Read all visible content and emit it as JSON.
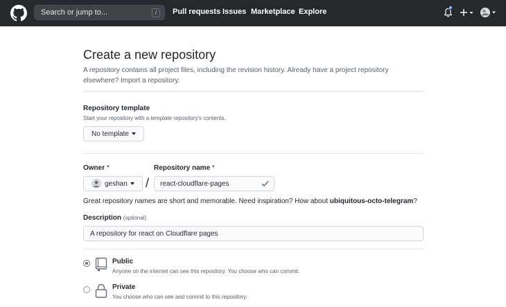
{
  "header": {
    "search_placeholder": "Search or jump to...",
    "search_key": "/",
    "nav": [
      "Pull requests",
      "Issues",
      "Marketplace",
      "Explore"
    ]
  },
  "page": {
    "title": "Create a new repository",
    "subtitle": "A repository contains all project files, including the revision history. Already have a project repository elsewhere?",
    "import_link": "Import a repository."
  },
  "template": {
    "label": "Repository template",
    "note": "Start your repository with a template repository's contents.",
    "button": "No template"
  },
  "owner": {
    "label": "Owner",
    "required": "*",
    "value": "geshan"
  },
  "repo": {
    "label": "Repository name",
    "required": "*",
    "separator": "/",
    "value": "react-cloudflare-pages"
  },
  "hint": {
    "text": "Great repository names are short and memorable. Need inspiration? How about",
    "suggestion": "ubiquitous-octo-telegram",
    "end": "?"
  },
  "description": {
    "label": "Description",
    "optional": "(optional)",
    "value": "A repository for react on Cloudflare pages"
  },
  "visibility": {
    "public_title": "Public",
    "public_desc": "Anyone on the internet can see this repository. You choose who can commit.",
    "private_title": "Private",
    "private_desc": "You choose who can see and commit to this repository.",
    "selected": "public"
  },
  "colors": {
    "header_bg": "#24292e",
    "text": "#24292e",
    "muted": "#586069",
    "border": "#e1e4e8"
  }
}
